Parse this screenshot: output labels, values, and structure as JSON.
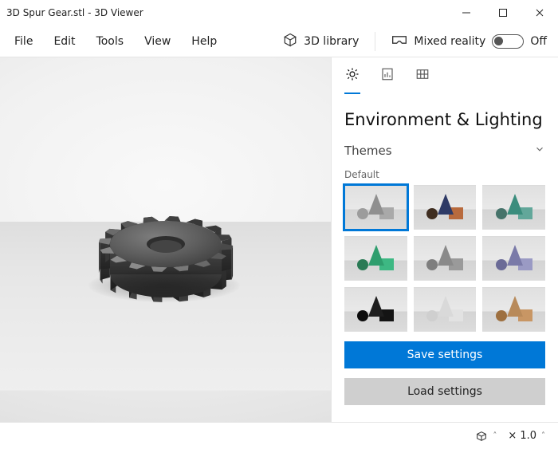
{
  "title": "3D Spur Gear.stl - 3D Viewer",
  "menu": {
    "items": [
      "File",
      "Edit",
      "Tools",
      "View",
      "Help"
    ]
  },
  "right_menu": {
    "library": "3D library",
    "mixed": "Mixed reality",
    "toggle_state": "Off"
  },
  "panel": {
    "tabs": [
      "lighting",
      "stats",
      "grid"
    ],
    "title": "Environment & Lighting",
    "section": "Themes",
    "selected_label": "Default",
    "save": "Save settings",
    "load": "Load settings"
  },
  "themes": [
    {
      "cone": "#8f8f8f",
      "cube": "#a9a9a9",
      "ball": "#9c9c9c",
      "sel": true
    },
    {
      "cone": "#2e3a66",
      "cube": "#b86a3d",
      "ball": "#3f2d20",
      "sel": false
    },
    {
      "cone": "#3b8d7d",
      "cube": "#62a79a",
      "ball": "#46736a",
      "sel": false
    },
    {
      "cone": "#2f9e6e",
      "cube": "#3db883",
      "ball": "#2a7a55",
      "sel": false
    },
    {
      "cone": "#8a8a8a",
      "cube": "#9a9a9a",
      "ball": "#7e7e7e",
      "sel": false
    },
    {
      "cone": "#7a7aa8",
      "cube": "#9a9ac4",
      "ball": "#6a6a96",
      "sel": false
    },
    {
      "cone": "#1e1e1e",
      "cube": "#141414",
      "ball": "#0c0c0c",
      "sel": false
    },
    {
      "cone": "#d9d9d9",
      "cube": "#e2e2e2",
      "ball": "#cfcfcf",
      "sel": false
    },
    {
      "cone": "#b88a5a",
      "cube": "#c89664",
      "ball": "#9e7040",
      "sel": false
    }
  ],
  "status": {
    "zoom_prefix": "×",
    "zoom": "1.0"
  }
}
